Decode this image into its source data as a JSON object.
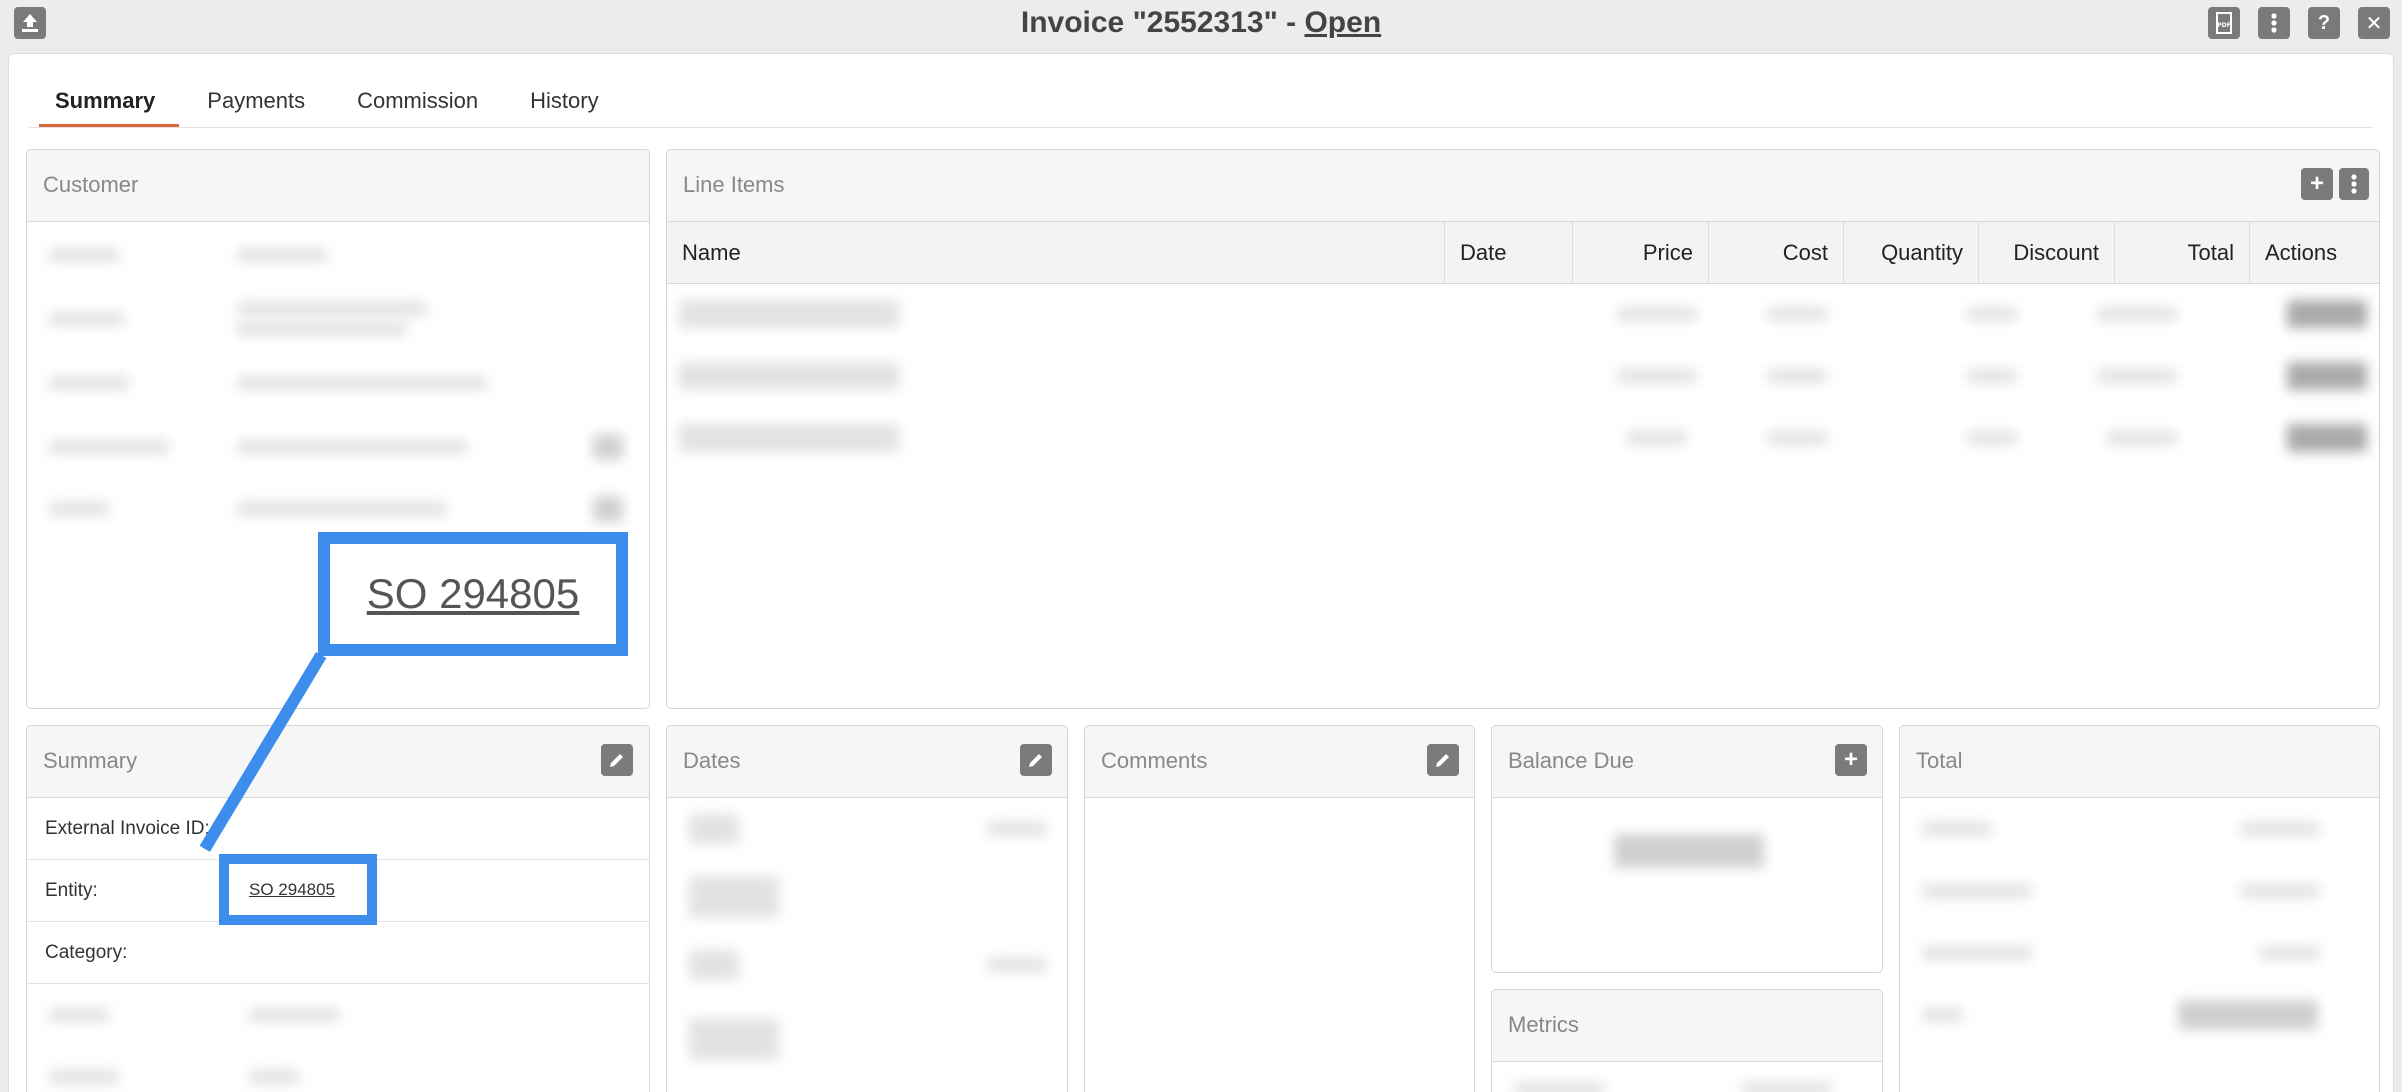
{
  "window": {
    "title_prefix": "Invoice \"2552313\" - ",
    "status": "Open",
    "icons": {
      "left": "upload-icon",
      "right": [
        "pdf-icon",
        "more-vertical-icon",
        "help-icon",
        "close-icon"
      ]
    }
  },
  "tabs": [
    "Summary",
    "Payments",
    "Commission",
    "History"
  ],
  "customer": {
    "title": "Customer"
  },
  "line_items": {
    "title": "Line Items",
    "columns": [
      "Name",
      "Date",
      "Price",
      "Cost",
      "Quantity",
      "Discount",
      "Total",
      "Actions"
    ]
  },
  "summary": {
    "title": "Summary",
    "rows": [
      {
        "label": "External Invoice ID:",
        "value": ""
      },
      {
        "label": "Entity:",
        "value": "SO 294805"
      },
      {
        "label": "Category:",
        "value": ""
      }
    ]
  },
  "dates": {
    "title": "Dates"
  },
  "comments": {
    "title": "Comments"
  },
  "balance_due": {
    "title": "Balance Due"
  },
  "metrics": {
    "title": "Metrics"
  },
  "total": {
    "title": "Total"
  },
  "callout": {
    "text": "SO 294805"
  },
  "colors": {
    "accent_tab": "#d9683c",
    "callout": "#3d8ded",
    "icon_bg": "#7b7b7b"
  }
}
